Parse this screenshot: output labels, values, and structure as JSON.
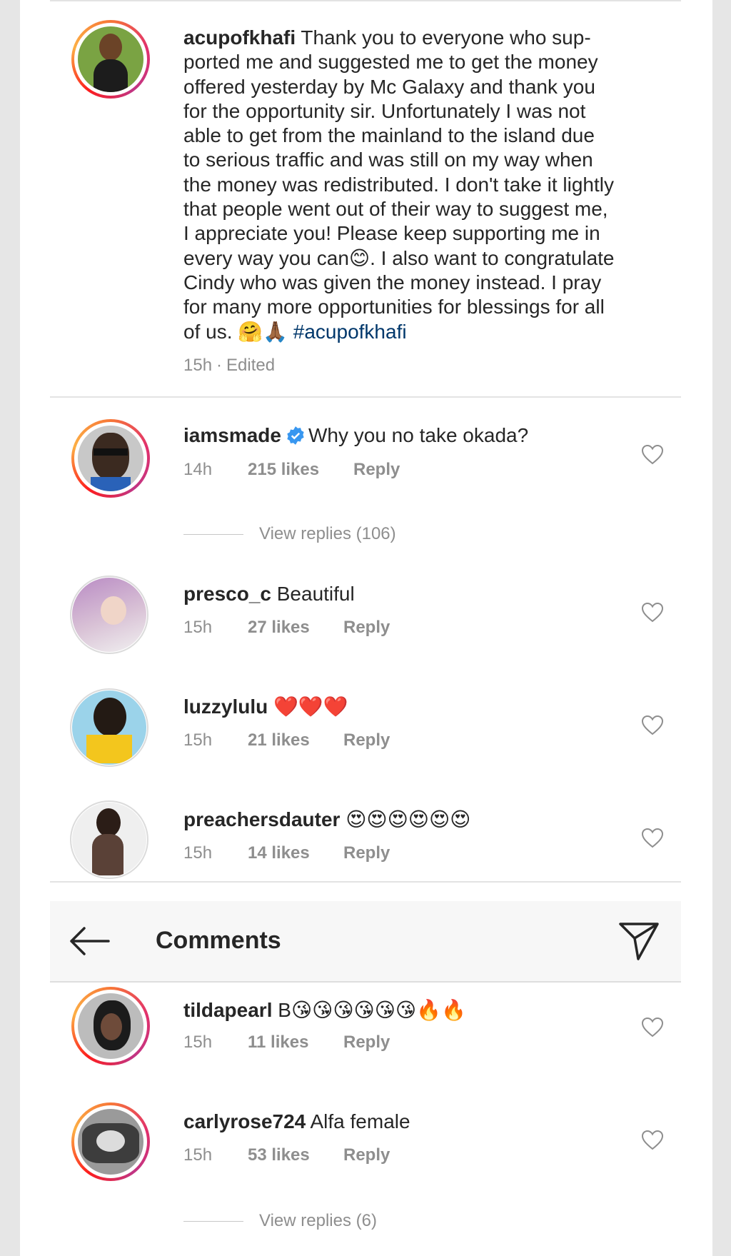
{
  "post": {
    "username": "acupofkhafi",
    "caption": "Thank you to everyone who sup-\nported me and suggested me to get the money\noffered yesterday by Mc Galaxy and thank you\nfor the opportunity sir. Unfortunately I was not\nable to get from the mainland to the island due\nto serious traffic and was still on my way when\nthe money was redistributed. I don't take it lightly\nthat people went out of their way to suggest me,\nI appreciate you! Please keep supporting me in\nevery way you can😊. I also want to congratulate\nCindy who was given the money instead. I pray\nfor many more opportunities for blessings for all\nof us. 🤗🙏🏾",
    "hashtag": "#acupofkhafi",
    "time": "15h",
    "separator": "·",
    "edited": "Edited"
  },
  "comments": [
    {
      "username": "iamsmade",
      "verified": true,
      "text": "Why you no take okada?",
      "time": "14h",
      "likes": "215 likes",
      "reply": "Reply",
      "view_replies": "View replies (106)"
    },
    {
      "username": "presco_c",
      "text": "Beautiful",
      "time": "15h",
      "likes": "27 likes",
      "reply": "Reply"
    },
    {
      "username": "luzzylulu",
      "text": "❤️❤️❤️",
      "time": "15h",
      "likes": "21 likes",
      "reply": "Reply"
    },
    {
      "username": "preachersdauter",
      "text": "😍😍😍😍😍😍",
      "time": "15h",
      "likes": "14 likes",
      "reply": "Reply"
    },
    {
      "username": "tildapearl",
      "text": "B😘😘😘😘😘😘🔥🔥",
      "time": "15h",
      "likes": "11 likes",
      "reply": "Reply"
    },
    {
      "username": "carlyrose724",
      "text": "Alfa female",
      "time": "15h",
      "likes": "53 likes",
      "reply": "Reply",
      "view_replies": "View replies (6)"
    }
  ],
  "header": {
    "title": "Comments",
    "back_icon": "arrow-left-icon",
    "share_icon": "paper-plane-icon"
  },
  "colors": {
    "text": "#262626",
    "secondary": "#8e8e8e",
    "hashtag": "#00376b",
    "verified": "#3897f0"
  }
}
